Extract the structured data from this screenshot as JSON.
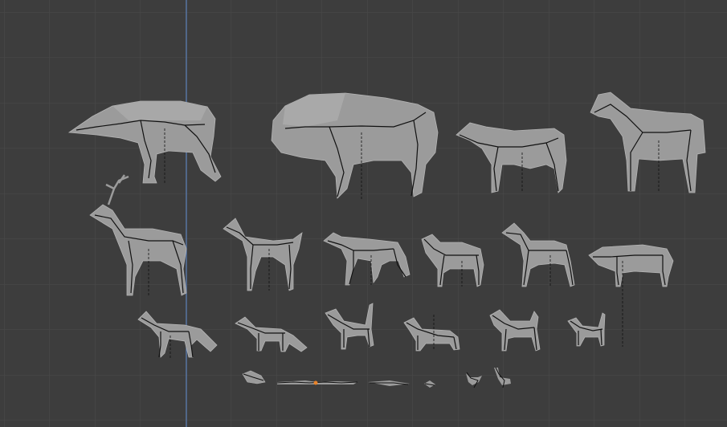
{
  "viewport": {
    "background_color": "#3d3d3d",
    "grid_minor_color": "#474747",
    "grid_major_color": "#333333",
    "axis_color": "#5b7fb8",
    "mesh_color": "#9a9a9a",
    "mesh_shade_color": "#7d7d7d",
    "bone_color": "#111111",
    "selected_color": "#e8832a"
  },
  "models": [
    {
      "id": "bear",
      "icon": "bear-mesh"
    },
    {
      "id": "bison",
      "icon": "bison-mesh"
    },
    {
      "id": "cow",
      "icon": "cow-mesh"
    },
    {
      "id": "horse",
      "icon": "horse-mesh"
    },
    {
      "id": "deer",
      "icon": "deer-mesh"
    },
    {
      "id": "antelope",
      "icon": "antelope-mesh"
    },
    {
      "id": "wolf",
      "icon": "wolf-mesh"
    },
    {
      "id": "sheep",
      "icon": "sheep-mesh"
    },
    {
      "id": "doberman",
      "icon": "doberman-mesh"
    },
    {
      "id": "boar",
      "icon": "boar-mesh"
    },
    {
      "id": "fox",
      "icon": "fox-mesh"
    },
    {
      "id": "fox-small",
      "icon": "fox-small-mesh"
    },
    {
      "id": "dog",
      "icon": "dog-mesh"
    },
    {
      "id": "dachshund",
      "icon": "dachshund-mesh"
    },
    {
      "id": "husky",
      "icon": "husky-mesh"
    },
    {
      "id": "cat",
      "icon": "cat-mesh"
    },
    {
      "id": "rat",
      "icon": "rat-mesh"
    },
    {
      "id": "snake",
      "icon": "snake-mesh"
    },
    {
      "id": "lizard",
      "icon": "lizard-mesh"
    },
    {
      "id": "frog",
      "icon": "frog-mesh"
    },
    {
      "id": "bird",
      "icon": "bird-mesh"
    },
    {
      "id": "goose",
      "icon": "goose-mesh"
    }
  ]
}
